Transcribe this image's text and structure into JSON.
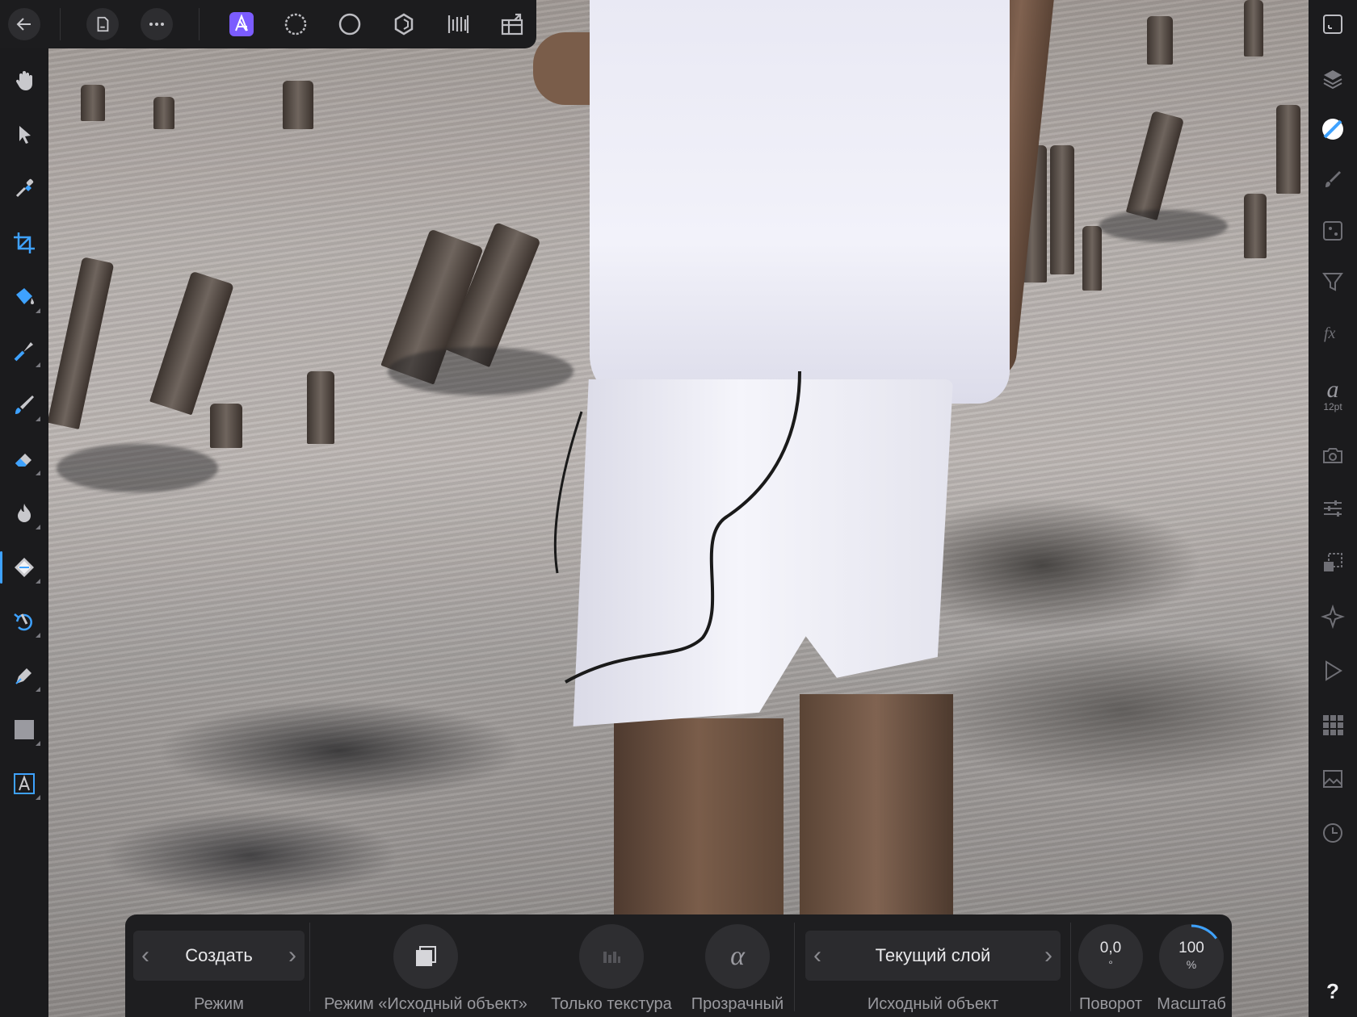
{
  "toolbar": {
    "back_icon": "back-arrow-icon",
    "document_icon": "document-icon",
    "more_icon": "more-icon",
    "personas": [
      "photo-persona-icon",
      "liquify-persona-icon",
      "develop-persona-icon",
      "tone-mapping-persona-icon",
      "export-persona-icon"
    ],
    "fullscreen_icon": "arrange-icon"
  },
  "context": {
    "mode_label": "Режим",
    "mode_value": "Создать",
    "source_mode_label": "Режим «Исходный объект»",
    "texture_only_label": "Только текстура",
    "transparent_label": "Прозрачный",
    "source_label": "Исходный объект",
    "source_value": "Текущий слой",
    "rotation_label": "Поворот",
    "rotation_value": "0,0",
    "rotation_unit": "°",
    "scale_label": "Масштаб",
    "scale_value": "100",
    "scale_unit": "%",
    "scale_fraction": 0.15
  },
  "right": {
    "text_size": "12pt",
    "help": "?"
  },
  "colors": {
    "accent": "#3ea2ff",
    "persona_active": "#7b5cff"
  }
}
